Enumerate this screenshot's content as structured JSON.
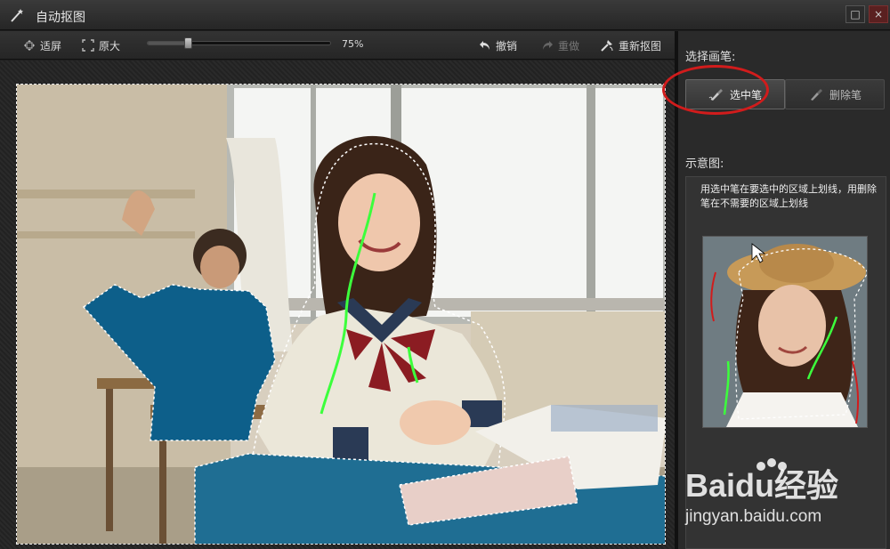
{
  "window": {
    "title": "自动抠图",
    "maximize_glyph": "□",
    "close_glyph": "×"
  },
  "toolbar": {
    "fit_label": "适屏",
    "original_label": "原大",
    "zoom_percent": "75%",
    "zoom_value": 0.22,
    "undo_label": "撤销",
    "redo_label": "重做",
    "redo_enabled": false,
    "rematte_label": "重新抠图"
  },
  "panel": {
    "select_pen_heading": "选择画笔:",
    "select_pen_label": "选中笔",
    "erase_pen_label": "删除笔",
    "example_heading": "示意图:",
    "hint_text": "用选中笔在要选中的区域上划线，用删除笔在不需要的区域上划线"
  },
  "watermark": {
    "brand": "Baidu经验",
    "url": "jingyan.baidu.com"
  },
  "colors": {
    "selection_overlay": "#0d5f8a",
    "select_stroke": "#3cff3c",
    "erase_stroke": "#d11c1c",
    "highlight_circle": "#d11c1c"
  }
}
